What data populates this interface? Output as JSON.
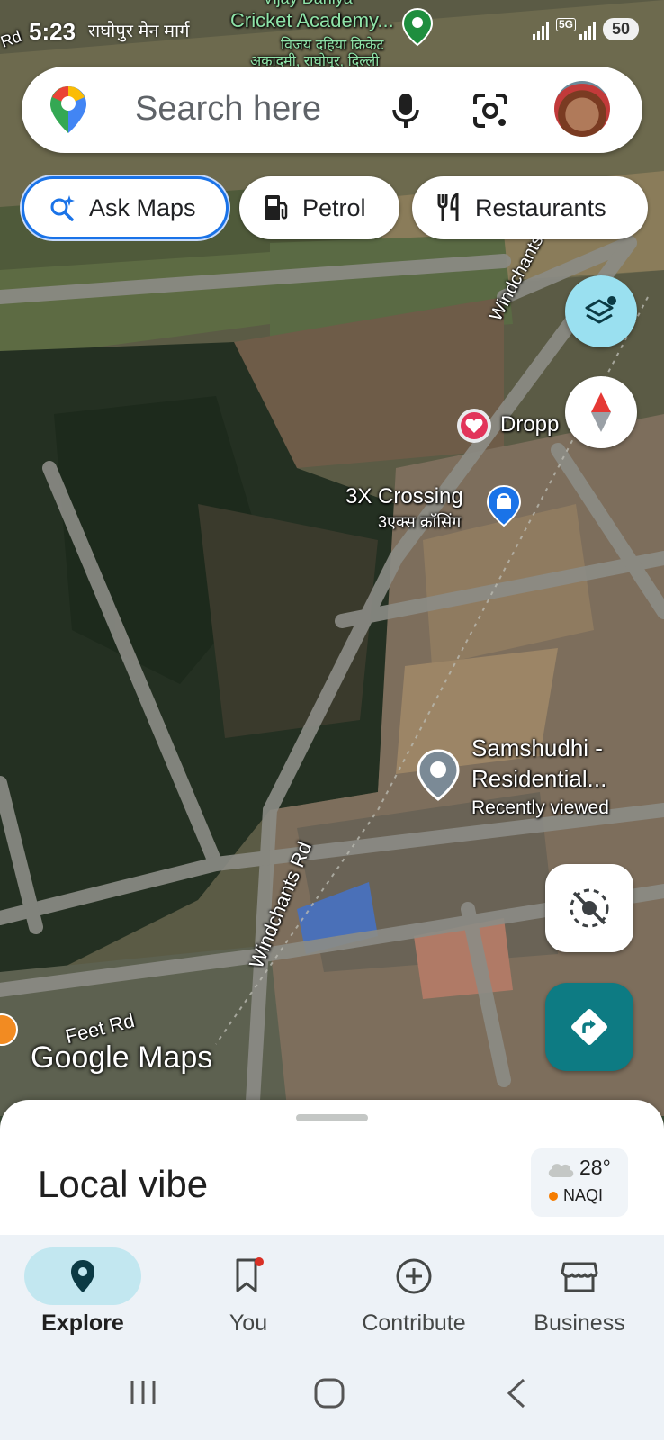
{
  "status_bar": {
    "time": "5:23",
    "road_label": "राघोपुर मेन मार्ग",
    "network": "5G",
    "battery": "50"
  },
  "search": {
    "placeholder": "Search here"
  },
  "chips": [
    {
      "label": "Ask Maps",
      "icon": "ask-maps-icon"
    },
    {
      "label": "Petrol",
      "icon": "fuel-pump-icon"
    },
    {
      "label": "Restaurants",
      "icon": "fork-knife-icon"
    }
  ],
  "map": {
    "place_top": "Vijay Dahiya",
    "place_top_line2": "Cricket Academy...",
    "place_top_hi": "विजय दहिया क्रिकेट",
    "place_top_hi2": "अकादमी, राघोपुर, दिल्ली",
    "road_windchants_top": "Windchants Rd",
    "road_windchants_bottom": "Windchants Rd",
    "place_dropp": "Dropp",
    "place_crossing": "3X Crossing",
    "place_crossing_hi": "3एक्स क्रॉसिंग",
    "place_samshudhi_1": "Samshudhi -",
    "place_samshudhi_2": "Residential...",
    "place_samshudhi_3": "Recently viewed",
    "road_feet": "Feet Rd",
    "edge_label": "Rd",
    "attribution": "Google Maps"
  },
  "sheet": {
    "title": "Local vibe",
    "temperature": "28°",
    "aqi": "NAQI"
  },
  "nav": [
    {
      "label": "Explore",
      "icon": "location-pin-icon",
      "active": true
    },
    {
      "label": "You",
      "icon": "bookmark-icon",
      "active": false
    },
    {
      "label": "Contribute",
      "icon": "add-circle-icon",
      "active": false
    },
    {
      "label": "Business",
      "icon": "storefront-icon",
      "active": false
    }
  ],
  "colors": {
    "accent": "#1a73e8",
    "directions": "#0d7b83",
    "layers": "#9ae0f0",
    "explore_active": "#c2e7f0"
  }
}
